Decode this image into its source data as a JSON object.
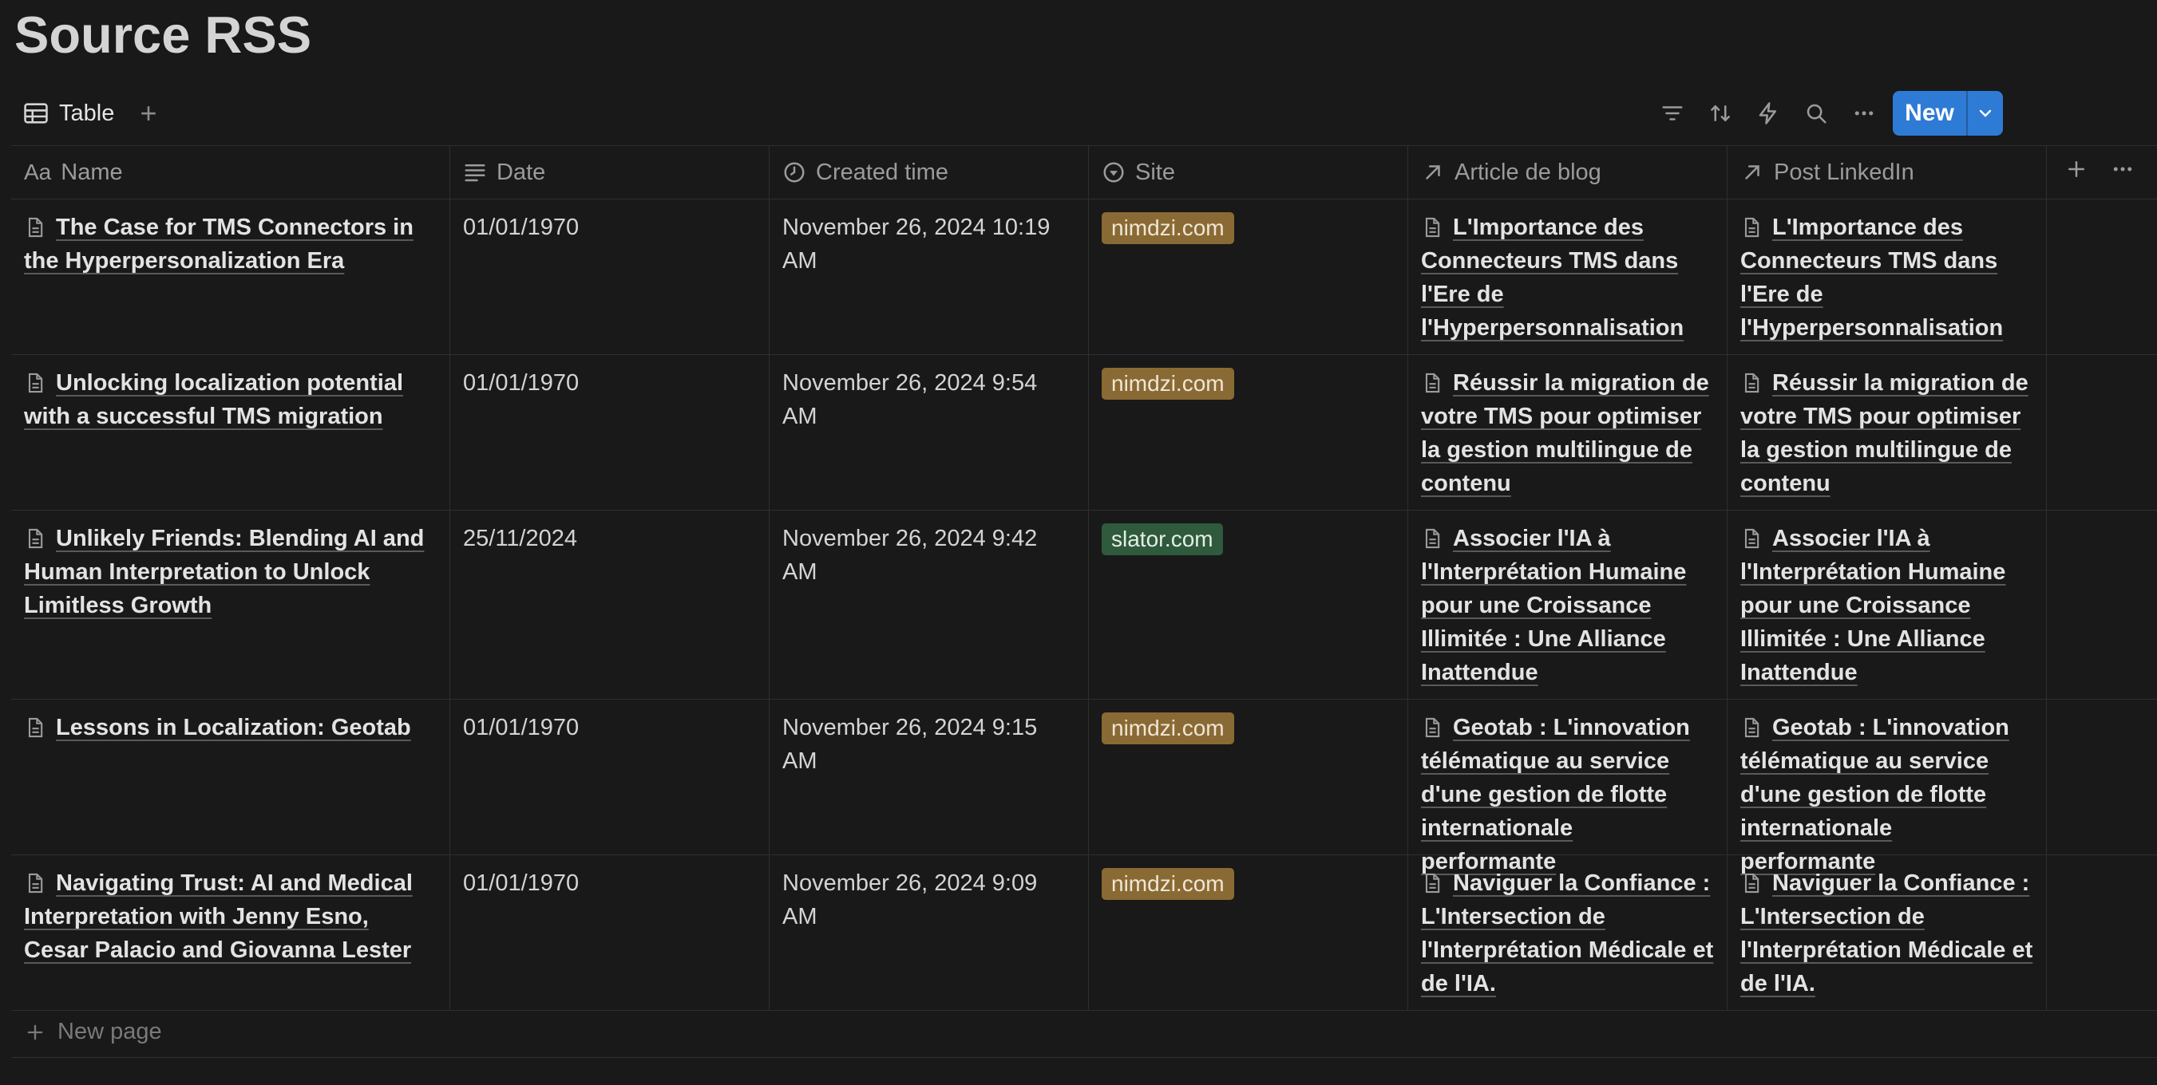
{
  "page": {
    "title": "Source RSS"
  },
  "toolbar": {
    "view_label": "Table",
    "new_label": "New",
    "icons": [
      "filter-icon",
      "sort-icon",
      "automation-icon",
      "search-icon",
      "more-icon"
    ]
  },
  "columns": [
    {
      "label": "Name",
      "icon": "title-icon",
      "prefix": "Aa"
    },
    {
      "label": "Date",
      "icon": "text-icon"
    },
    {
      "label": "Created time",
      "icon": "clock-icon"
    },
    {
      "label": "Site",
      "icon": "select-icon"
    },
    {
      "label": "Article de blog",
      "icon": "relation-icon"
    },
    {
      "label": "Post LinkedIn",
      "icon": "relation-icon"
    }
  ],
  "colors": {
    "nimdzi": "#8a6a34",
    "slator": "#2f5a3c",
    "accent": "#2e7bd6"
  },
  "rows": [
    {
      "name": "The Case for TMS Connectors in the Hyperpersonalization Era",
      "date": "01/01/1970",
      "created": "November 26, 2024 10:19 AM",
      "site": "nimdzi.com",
      "blog": "L'Importance des Connecteurs TMS dans l'Ere de l'Hyperpersonnalisation",
      "post": "L'Importance des Connecteurs TMS dans l'Ere de l'Hyperpersonnalisation"
    },
    {
      "name": "Unlocking localization potential with a successful TMS migration",
      "date": "01/01/1970",
      "created": "November 26, 2024 9:54 AM",
      "site": "nimdzi.com",
      "blog": "Réussir la migration de votre TMS pour optimiser la gestion multilingue de contenu",
      "post": "Réussir la migration de votre TMS pour optimiser la gestion multilingue de contenu"
    },
    {
      "name": "Unlikely Friends: Blending AI and Human Interpretation to Unlock Limitless Growth",
      "date": "25/11/2024",
      "created": "November 26, 2024 9:42 AM",
      "site": "slator.com",
      "blog": "Associer l'IA à l'Interprétation Humaine pour une Croissance Illimitée : Une Alliance Inattendue",
      "post": "Associer l'IA à l'Interprétation Humaine pour une Croissance Illimitée : Une Alliance Inattendue"
    },
    {
      "name": "Lessons in Localization: Geotab",
      "date": "01/01/1970",
      "created": "November 26, 2024 9:15 AM",
      "site": "nimdzi.com",
      "blog": "Geotab : L'innovation télématique au service d'une gestion de flotte internationale performante",
      "post": "Geotab : L'innovation télématique au service d'une gestion de flotte internationale performante"
    },
    {
      "name": "Navigating Trust: AI and Medical Interpretation with Jenny Esno, Cesar Palacio and Giovanna Lester",
      "date": "01/01/1970",
      "created": "November 26, 2024 9:09 AM",
      "site": "nimdzi.com",
      "blog": "Naviguer la Confiance : L'Intersection de l'Interprétation Médicale et de l'IA.",
      "post": "Naviguer la Confiance : L'Intersection de l'Interprétation Médicale et de l'IA."
    }
  ],
  "footer": {
    "new_page_label": "New page"
  }
}
